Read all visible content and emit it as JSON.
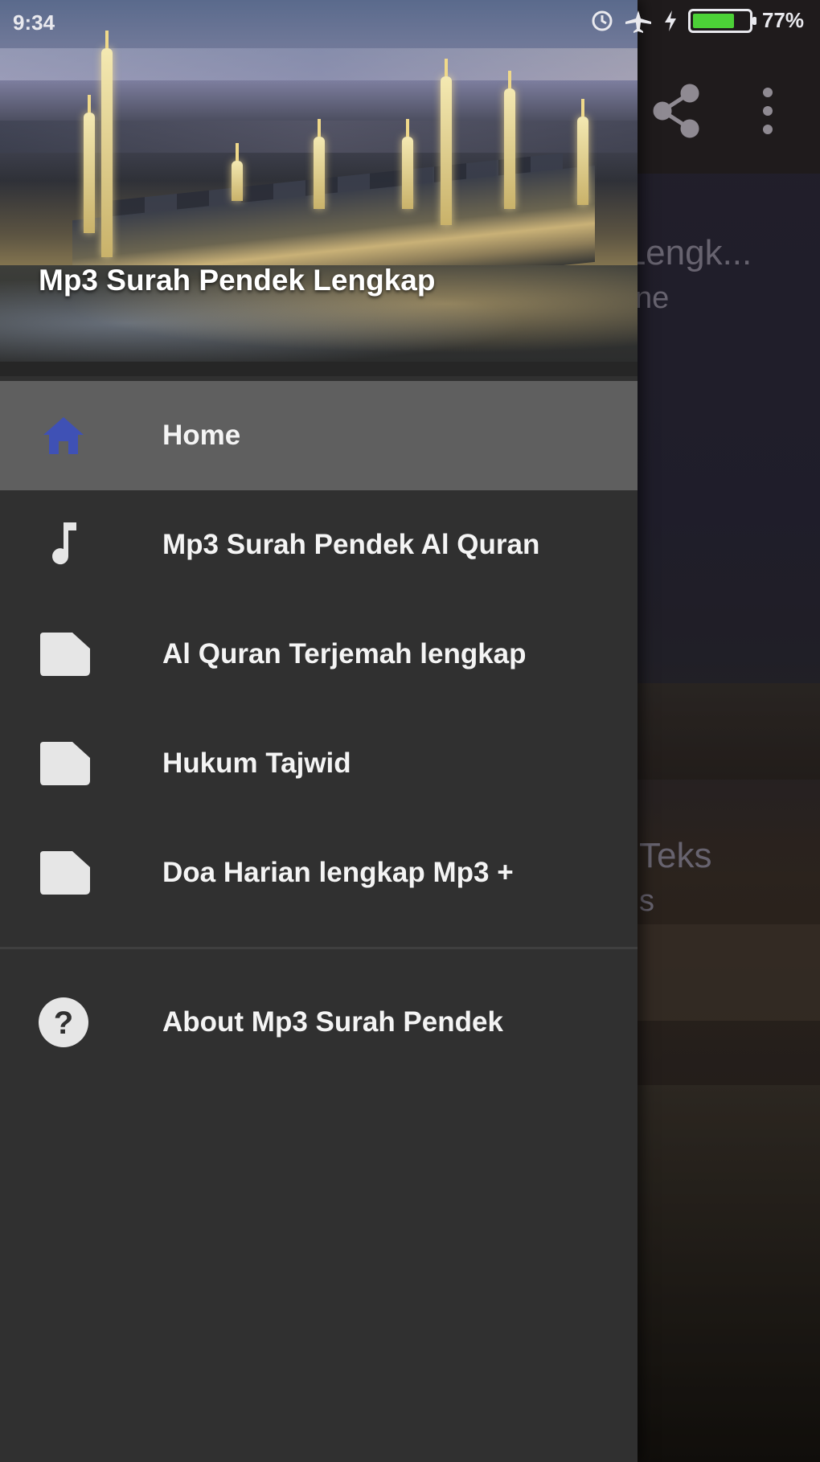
{
  "status_bar": {
    "time": "9:34",
    "battery_percent_label": "77%",
    "battery_level": 0.77,
    "battery_color": "#4cd137"
  },
  "background_screen": {
    "title_fragment": "h Lengk...",
    "subtitle_fragment": "ne",
    "item_fragment_1": "Teks",
    "item_fragment_2": "s",
    "actions": [
      "share-icon",
      "more-vert-icon"
    ]
  },
  "drawer": {
    "header_title": "Mp3 Surah Pendek Lengkap",
    "items": [
      {
        "label": "Home",
        "icon": "home-icon",
        "active": true,
        "icon_color": "#3f51b5"
      },
      {
        "label": "Mp3 Surah Pendek Al Quran",
        "icon": "music-note-icon",
        "active": false
      },
      {
        "label": "Al Quran Terjemah lengkap",
        "icon": "document-icon",
        "active": false
      },
      {
        "label": "Hukum Tajwid",
        "icon": "document-icon",
        "active": false
      },
      {
        "label": "Doa Harian lengkap Mp3 +",
        "icon": "document-icon",
        "active": false
      }
    ],
    "secondary_items": [
      {
        "label": "About Mp3 Surah Pendek",
        "icon": "help-icon"
      }
    ]
  },
  "colors": {
    "drawer_bg": "#303030",
    "active_item_bg": "#5f5f5f",
    "accent": "#3f51b5"
  }
}
